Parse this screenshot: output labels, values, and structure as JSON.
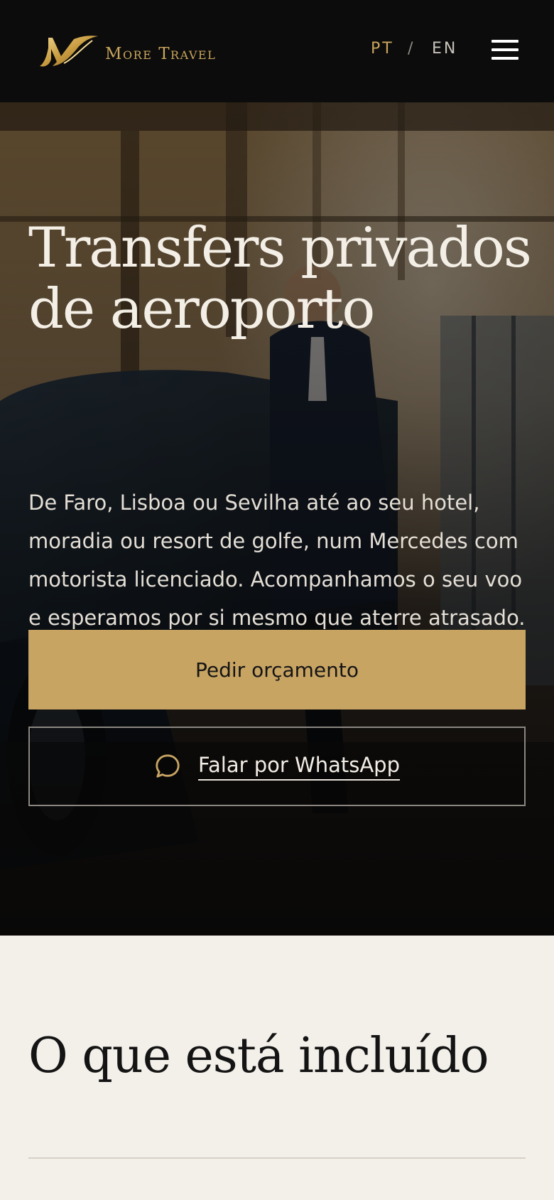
{
  "header": {
    "brand_name": "More Travel",
    "logo_icon": "mt-monogram-logo",
    "lang_pt": "PT",
    "lang_separator": "/",
    "lang_en": "EN",
    "menu_icon": "hamburger-menu-icon"
  },
  "hero": {
    "title": "Transfers privados de aeroporto",
    "description": "De Faro, Lisboa ou Sevilha até ao seu hotel, moradia ou resort de golfe, num Mercedes com motorista licenciado. Acompanhamos o seu voo e esperamos por si mesmo que aterre atrasado.",
    "quote_button": "Pedir orçamento",
    "whatsapp_button": "Falar por WhatsApp",
    "whatsapp_icon": "chat-bubble-icon"
  },
  "included": {
    "title": "O que está incluído"
  },
  "colors": {
    "header_bg": "#0c0c0c",
    "gold": "#c8a463",
    "page_bg": "#f3efe9",
    "title_dark": "#141414"
  }
}
